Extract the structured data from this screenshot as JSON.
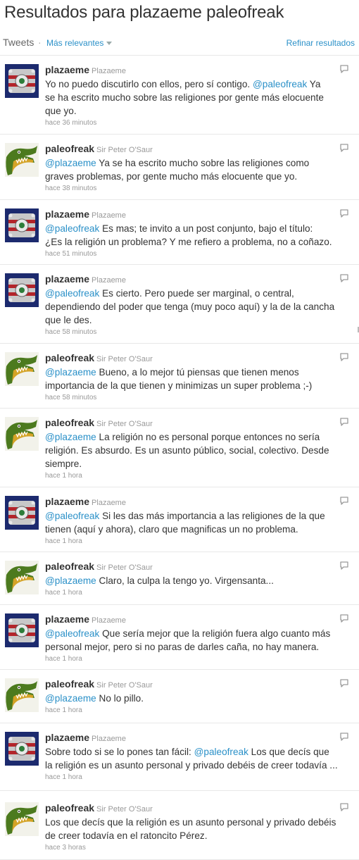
{
  "header": {
    "title": "Resultados para plazaeme paleofreak",
    "tweets_label": "Tweets",
    "sep": "·",
    "sort_label": "Más relevantes",
    "refine_label": "Refinar resultados"
  },
  "colors": {
    "link": "#2a90c8",
    "text": "#333333",
    "meta": "#999999"
  },
  "tweets": [
    {
      "user": "plazaeme",
      "name": "Plazaeme",
      "avatar": "plazaeme-avatar",
      "time": "hace 36 minutos",
      "lines": [
        {
          "pre": "Yo no puedo discutirlo con ellos, pero sí contigo. ",
          "mention": "@paleofreak",
          "post": " Ya"
        },
        {
          "pre": "se ha escrito mucho sobre las religiones por gente más elocuente",
          "mention": "",
          "post": ""
        },
        {
          "pre": "que yo.",
          "mention": "",
          "post": ""
        }
      ]
    },
    {
      "user": "paleofreak",
      "name": "Sir Peter O'Saur",
      "avatar": "paleofreak-avatar",
      "time": "hace 38 minutos",
      "lines": [
        {
          "pre": "",
          "mention": "@plazaeme",
          "post": " Ya se ha escrito mucho sobre las religiones como"
        },
        {
          "pre": "graves problemas, por gente mucho más elocuente que yo.",
          "mention": "",
          "post": ""
        }
      ]
    },
    {
      "user": "plazaeme",
      "name": "Plazaeme",
      "avatar": "plazaeme-avatar",
      "time": "hace 51 minutos",
      "lines": [
        {
          "pre": "",
          "mention": "@paleofreak",
          "post": " Es mas; te invito a un post conjunto, bajo el título:"
        },
        {
          "pre": "¿Es la religión un problema? Y me refiero a problema, no a coñazo.",
          "mention": "",
          "post": ""
        }
      ]
    },
    {
      "user": "plazaeme",
      "name": "Plazaeme",
      "avatar": "plazaeme-avatar",
      "time": "hace 58 minutos",
      "lines": [
        {
          "pre": "",
          "mention": "@paleofreak",
          "post": " Es cierto. Pero puede ser marginal, o central,"
        },
        {
          "pre": "dependiendo del poder que tenga (muy poco aquí) y la de la cancha",
          "mention": "",
          "post": ""
        },
        {
          "pre": "que le des.",
          "mention": "",
          "post": ""
        }
      ]
    },
    {
      "user": "paleofreak",
      "name": "Sir Peter O'Saur",
      "avatar": "paleofreak-avatar",
      "time": "hace 58 minutos",
      "lines": [
        {
          "pre": "",
          "mention": "@plazaeme",
          "post": " Bueno, a lo mejor tú piensas que tienen menos"
        },
        {
          "pre": "importancia de la que tienen y minimizas un super problema ;-)",
          "mention": "",
          "post": ""
        }
      ]
    },
    {
      "user": "paleofreak",
      "name": "Sir Peter O'Saur",
      "avatar": "paleofreak-avatar",
      "time": "hace 1 hora",
      "lines": [
        {
          "pre": "",
          "mention": "@plazaeme",
          "post": " La religión no es personal porque entonces no sería"
        },
        {
          "pre": "religión. Es absurdo. Es un asunto público, social, colectivo. Desde",
          "mention": "",
          "post": ""
        },
        {
          "pre": "siempre.",
          "mention": "",
          "post": ""
        }
      ]
    },
    {
      "user": "plazaeme",
      "name": "Plazaeme",
      "avatar": "plazaeme-avatar",
      "time": "hace 1 hora",
      "lines": [
        {
          "pre": "",
          "mention": "@paleofreak",
          "post": " Si les das más importancia a las religiones de la que"
        },
        {
          "pre": "tienen (aquí y ahora), claro que magnificas un no problema.",
          "mention": "",
          "post": ""
        }
      ]
    },
    {
      "user": "paleofreak",
      "name": "Sir Peter O'Saur",
      "avatar": "paleofreak-avatar",
      "time": "hace 1 hora",
      "lines": [
        {
          "pre": "",
          "mention": "@plazaeme",
          "post": " Claro, la culpa la tengo yo. Virgensanta..."
        }
      ]
    },
    {
      "user": "plazaeme",
      "name": "Plazaeme",
      "avatar": "plazaeme-avatar",
      "time": "hace 1 hora",
      "lines": [
        {
          "pre": "",
          "mention": "@paleofreak",
          "post": " Que sería mejor que la religión fuera algo cuanto más"
        },
        {
          "pre": "personal mejor, pero si no paras de darles caña, no hay manera.",
          "mention": "",
          "post": ""
        }
      ]
    },
    {
      "user": "paleofreak",
      "name": "Sir Peter O'Saur",
      "avatar": "paleofreak-avatar",
      "time": "hace 1 hora",
      "lines": [
        {
          "pre": "",
          "mention": "@plazaeme",
          "post": " No lo pillo."
        }
      ]
    },
    {
      "user": "plazaeme",
      "name": "Plazaeme",
      "avatar": "plazaeme-avatar",
      "time": "hace 1 hora",
      "lines": [
        {
          "pre": "Sobre todo si se lo pones tan fácil: ",
          "mention": "@paleofreak",
          "post": " Los que decís que"
        },
        {
          "pre": "la religión es un asunto personal y privado debéis de creer todavía ...",
          "mention": "",
          "post": ""
        }
      ]
    },
    {
      "user": "paleofreak",
      "name": "Sir Peter O'Saur",
      "avatar": "paleofreak-avatar",
      "time": "hace 3 horas",
      "lines": [
        {
          "pre": "Los que decís que la religión es un asunto personal y privado debéis",
          "mention": "",
          "post": ""
        },
        {
          "pre": "de creer todavía en el ratoncito Pérez.",
          "mention": "",
          "post": ""
        }
      ]
    }
  ]
}
